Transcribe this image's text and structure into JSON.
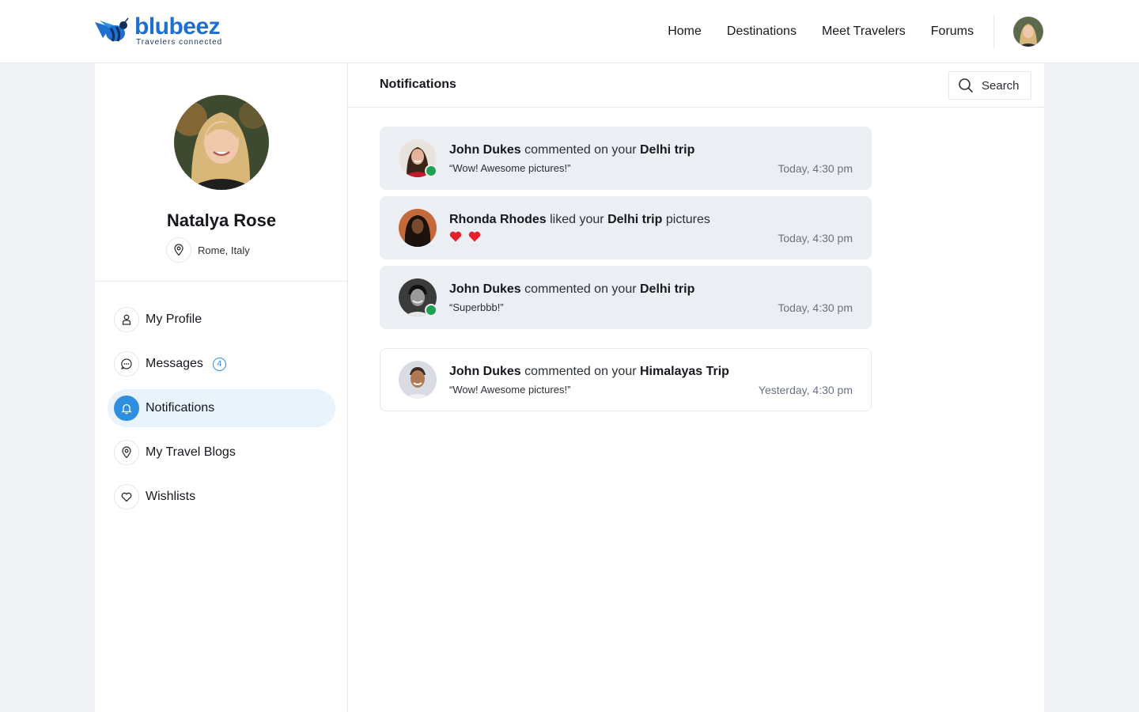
{
  "brand": {
    "name": "blubeez",
    "tagline": "Travelers connected"
  },
  "nav": {
    "items": [
      "Home",
      "Destinations",
      "Meet Travelers",
      "Forums"
    ]
  },
  "profile": {
    "name": "Natalya Rose",
    "location": "Rome, Italy"
  },
  "menu": {
    "my_profile": "My Profile",
    "messages": "Messages",
    "messages_count": "4",
    "notifications": "Notifications",
    "travel_blogs": "My Travel Blogs",
    "wishlists": "Wishlists"
  },
  "main": {
    "title": "Notifications",
    "search_label": "Search"
  },
  "notifications": [
    {
      "user": "John Dukes",
      "action": "commented on your",
      "target": "Delhi trip",
      "suffix": "",
      "detail": "“Wow! Awesome pictures!”",
      "time": "Today, 4:30 pm",
      "online": true,
      "unread": true
    },
    {
      "user": "Rhonda Rhodes",
      "action": "liked your",
      "target": "Delhi trip",
      "suffix": "pictures",
      "detail": "",
      "hearts": 2,
      "time": "Today, 4:30 pm",
      "online": false,
      "unread": true
    },
    {
      "user": "John Dukes",
      "action": "commented on your",
      "target": "Delhi trip",
      "suffix": "",
      "detail": "“Superbbb!”",
      "time": "Today, 4:30 pm",
      "online": true,
      "unread": true
    },
    {
      "user": "John Dukes",
      "action": "commented on your",
      "target": "Himalayas Trip",
      "suffix": "",
      "detail": "“Wow! Awesome pictures!”",
      "time": "Yesterday, 4:30 pm",
      "online": false,
      "unread": false
    }
  ],
  "colors": {
    "brand": "#1f6fd1",
    "accent": "#2f8fde",
    "online": "#1fa053",
    "heart": "#e8202a",
    "unread_bg": "#ebeef3"
  }
}
